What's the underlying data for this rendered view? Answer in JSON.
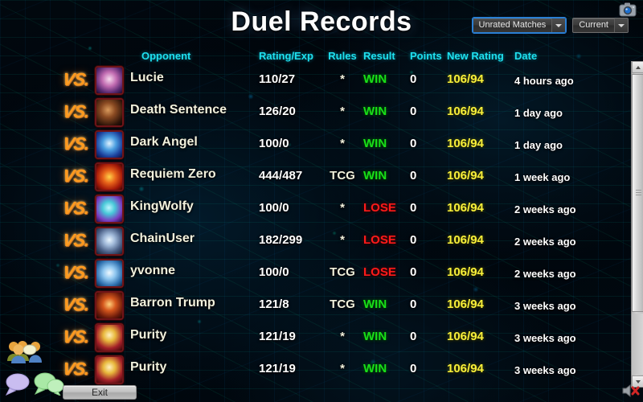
{
  "window": {
    "title": "Duel Records",
    "camera_icon": "camera-icon",
    "mute_icon": "speaker-muted-icon"
  },
  "filters": {
    "match_type": {
      "value": "Unrated Matches",
      "icon": "chevron-down-icon"
    },
    "period": {
      "value": "Current",
      "icon": "chevron-down-icon"
    }
  },
  "table": {
    "columns": {
      "opponent": "Opponent",
      "rating_exp": "Rating/Exp",
      "rules": "Rules",
      "result": "Result",
      "points": "Points",
      "new_rating": "New Rating",
      "date": "Date"
    },
    "vs_label": "VS.",
    "rows": [
      {
        "opponent": "Lucie",
        "rating_exp": "110/27",
        "rules": "*",
        "result": "WIN",
        "points": "0",
        "new_rating": "106/94",
        "date": "4 hours ago",
        "avatar": "card-avatar-lucie"
      },
      {
        "opponent": "Death Sentence",
        "rating_exp": "126/20",
        "rules": "*",
        "result": "WIN",
        "points": "0",
        "new_rating": "106/94",
        "date": "1 day ago",
        "avatar": "card-avatar-death-sentence"
      },
      {
        "opponent": "Dark Angel",
        "rating_exp": "100/0",
        "rules": "*",
        "result": "WIN",
        "points": "0",
        "new_rating": "106/94",
        "date": "1 day ago",
        "avatar": "card-avatar-dark-angel"
      },
      {
        "opponent": "Requiem Zero",
        "rating_exp": "444/487",
        "rules": "TCG",
        "result": "WIN",
        "points": "0",
        "new_rating": "106/94",
        "date": "1 week ago",
        "avatar": "card-avatar-requiem-zero"
      },
      {
        "opponent": "KingWolfy",
        "rating_exp": "100/0",
        "rules": "*",
        "result": "LOSE",
        "points": "0",
        "new_rating": "106/94",
        "date": "2 weeks ago",
        "avatar": "card-avatar-kingwolfy"
      },
      {
        "opponent": "ChainUser",
        "rating_exp": "182/299",
        "rules": "*",
        "result": "LOSE",
        "points": "0",
        "new_rating": "106/94",
        "date": "2 weeks ago",
        "avatar": "card-avatar-chainuser"
      },
      {
        "opponent": "yvonne",
        "rating_exp": "100/0",
        "rules": "TCG",
        "result": "LOSE",
        "points": "0",
        "new_rating": "106/94",
        "date": "2 weeks ago",
        "avatar": "card-avatar-yvonne"
      },
      {
        "opponent": "Barron Trump",
        "rating_exp": "121/8",
        "rules": "TCG",
        "result": "WIN",
        "points": "0",
        "new_rating": "106/94",
        "date": "3 weeks ago",
        "avatar": "card-avatar-barron-trump"
      },
      {
        "opponent": "Purity",
        "rating_exp": "121/19",
        "rules": "*",
        "result": "WIN",
        "points": "0",
        "new_rating": "106/94",
        "date": "3 weeks ago",
        "avatar": "card-avatar-purity-1"
      },
      {
        "opponent": "Purity",
        "rating_exp": "121/19",
        "rules": "*",
        "result": "WIN",
        "points": "0",
        "new_rating": "106/94",
        "date": "3 weeks ago",
        "avatar": "card-avatar-purity-2"
      }
    ]
  },
  "footer": {
    "exit_label": "Exit",
    "friends_icon": "friends-icon",
    "chat_icon": "chat-bubble-icon",
    "chat_group_icon": "chat-bubbles-group-icon"
  },
  "scrollbar": {
    "up_icon": "scroll-up-arrow-icon",
    "down_icon": "scroll-down-arrow-icon"
  },
  "colors": {
    "header_text": "#1fe0ef",
    "name_text": "#f2f1dd",
    "win": "#19e019",
    "lose": "#ff1a1a",
    "new_rating": "#f8f03a",
    "vs": "#ff9a1e",
    "title": "#ffffff"
  }
}
